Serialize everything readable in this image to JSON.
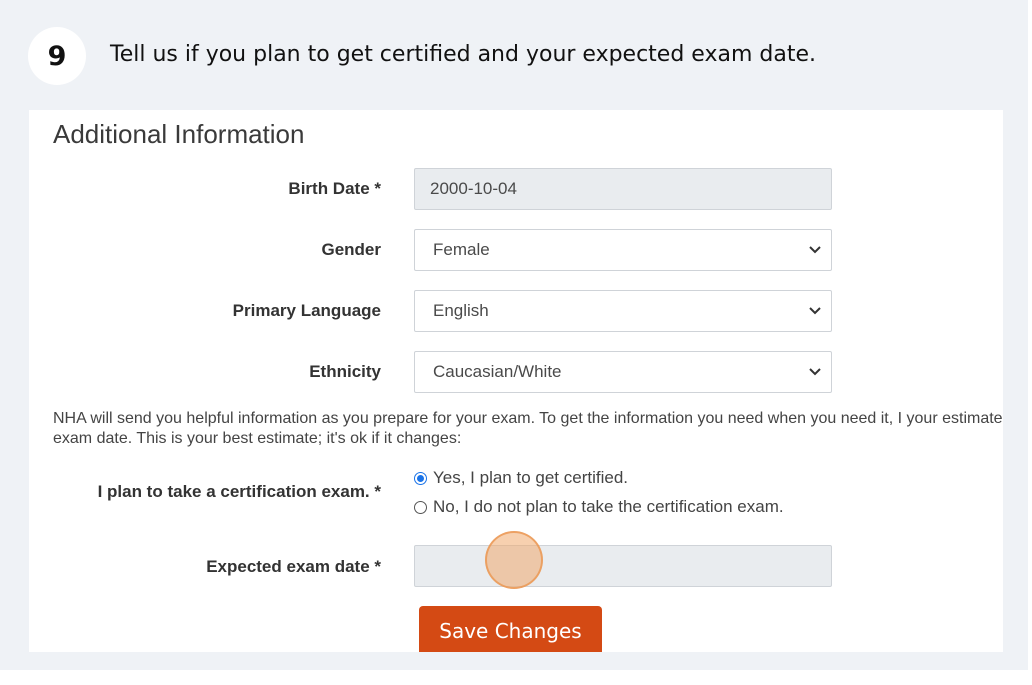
{
  "step": {
    "number": "9",
    "instruction": "Tell us if you plan to get certified and your expected exam date."
  },
  "form": {
    "section_title": "Additional Information",
    "birth_date": {
      "label": "Birth Date *",
      "value": "2000-10-04"
    },
    "gender": {
      "label": "Gender",
      "value": "Female"
    },
    "primary_language": {
      "label": "Primary Language",
      "value": "English"
    },
    "ethnicity": {
      "label": "Ethnicity",
      "value": "Caucasian/White"
    },
    "note": "NHA will send you helpful information as you prepare for your exam. To get the information you need when you need it, I your estimated exam date. This is your best estimate; it's ok if it changes:",
    "certification": {
      "label": "I plan to take a certification exam. *",
      "options": [
        {
          "label": "Yes, I plan to get certified.",
          "checked": true
        },
        {
          "label": "No, I do not plan to take the certification exam.",
          "checked": false
        }
      ]
    },
    "exam_date": {
      "label": "Expected exam date *",
      "value": ""
    },
    "save_label": "Save Changes"
  },
  "colors": {
    "accent": "#d44a14",
    "radio_selected": "#1a73e8",
    "background": "#eff2f6"
  }
}
